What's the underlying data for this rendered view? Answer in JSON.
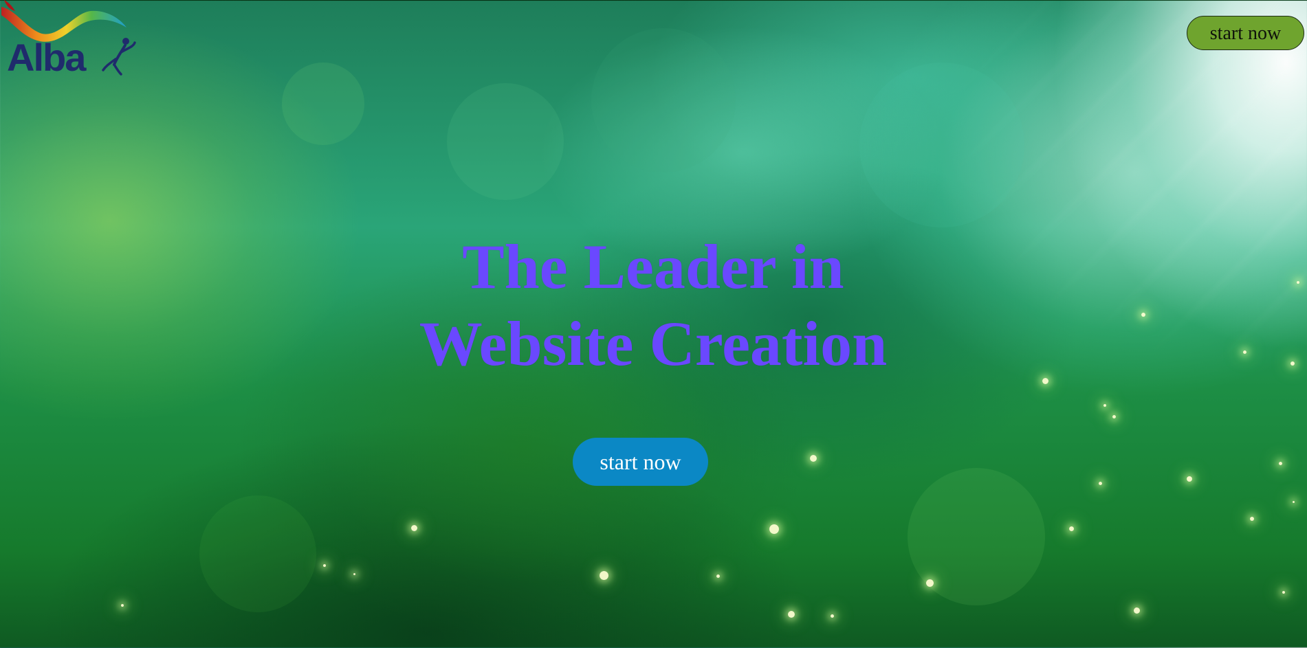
{
  "header": {
    "logo": {
      "wordmark": "Alba"
    },
    "cta_label": "start now"
  },
  "hero": {
    "title_line1": "The Leader in",
    "title_line2": "Website Creation",
    "cta_label": "start now"
  },
  "colors": {
    "top_cta_bg": "#6fa42e",
    "hero_cta_bg": "#0b88c5",
    "hero_title": "#6a48ff",
    "logo_text": "#1f2b6c"
  },
  "icons": {
    "logo_icon": "paint-swoosh-person-icon"
  }
}
